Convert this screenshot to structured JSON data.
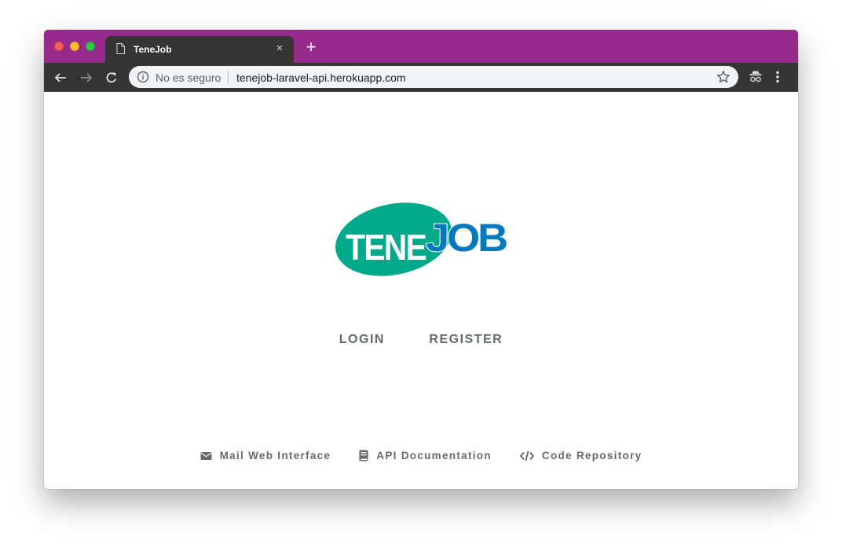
{
  "browser": {
    "tab": {
      "title": "TeneJob",
      "close_glyph": "×"
    },
    "new_tab_glyph": "+",
    "address_bar": {
      "security_label": "No es seguro",
      "url": "tenejob-laravel-api.herokuapp.com"
    },
    "colors": {
      "tabbar": "#962b8d",
      "toolbar": "#353535"
    }
  },
  "page": {
    "logo": {
      "left_text": "TENE",
      "right_text": "JOB",
      "green": "#00a98a",
      "blue": "#0078be"
    },
    "nav": {
      "login": "LOGIN",
      "register": "REGISTER"
    },
    "footer": {
      "mail": {
        "label": "Mail Web Interface",
        "icon": "envelope-icon"
      },
      "api": {
        "label": "API Documentation",
        "icon": "book-icon"
      },
      "code": {
        "label": "Code Repository",
        "icon": "code-icon"
      }
    }
  }
}
